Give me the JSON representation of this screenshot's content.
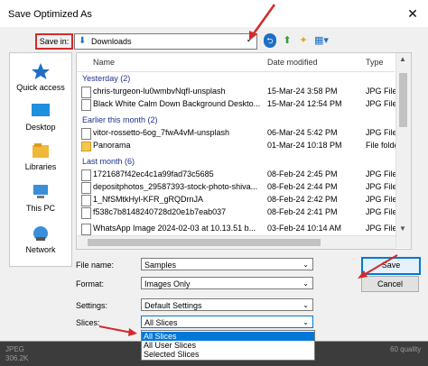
{
  "window": {
    "title": "Save Optimized As",
    "close_glyph": "✕"
  },
  "save_in": {
    "label": "Save in:",
    "location": "Downloads",
    "toolbar": {
      "back": "⮌",
      "up": "⬆",
      "new_folder": "✦",
      "views": "▦▾"
    }
  },
  "places": [
    {
      "label": "Quick access",
      "icon": "star-icon"
    },
    {
      "label": "Desktop",
      "icon": "desktop-icon"
    },
    {
      "label": "Libraries",
      "icon": "libraries-icon"
    },
    {
      "label": "This PC",
      "icon": "computer-icon"
    },
    {
      "label": "Network",
      "icon": "network-icon"
    }
  ],
  "file_list": {
    "columns": [
      "Name",
      "Date modified",
      "Type"
    ],
    "groups": [
      {
        "title": "Yesterday (2)",
        "rows": [
          {
            "name": "chris-turgeon-lu0wmbvNqfI-unsplash",
            "date": "15-Mar-24 3:58 PM",
            "type": "JPG File",
            "kind": "file"
          },
          {
            "name": "Black White Calm Down Background Deskto...",
            "date": "15-Mar-24 12:54 PM",
            "type": "JPG File",
            "kind": "file"
          }
        ]
      },
      {
        "title": "Earlier this month (2)",
        "rows": [
          {
            "name": "vitor-rossetto-6og_7fwA4vM-unsplash",
            "date": "06-Mar-24 5:42 PM",
            "type": "JPG File",
            "kind": "file"
          },
          {
            "name": "Panorama",
            "date": "01-Mar-24 10:18 PM",
            "type": "File folder",
            "kind": "folder"
          }
        ]
      },
      {
        "title": "Last month (6)",
        "rows": [
          {
            "name": "1721687f42ec4c1a99fad73c5685",
            "date": "08-Feb-24 2:45 PM",
            "type": "JPG File",
            "kind": "file"
          },
          {
            "name": "depositphotos_29587393-stock-photo-shiva...",
            "date": "08-Feb-24 2:44 PM",
            "type": "JPG File",
            "kind": "file"
          },
          {
            "name": "1_NfSMtkHyl-KFR_gRQDrnJA",
            "date": "08-Feb-24 2:42 PM",
            "type": "JPG File",
            "kind": "file"
          },
          {
            "name": "f538c7b8148240728d20e1b7eab037",
            "date": "08-Feb-24 2:41 PM",
            "type": "JPG File",
            "kind": "file"
          },
          {
            "name": "WhatsApp Image 2024-02-03 at 10.13.51 b...",
            "date": "03-Feb-24 10:14 AM",
            "type": "JPG File",
            "kind": "file"
          }
        ]
      }
    ]
  },
  "form": {
    "file_name_label": "File name:",
    "file_name_value": "Samples",
    "format_label": "Format:",
    "format_value": "Images Only",
    "settings_label": "Settings:",
    "settings_value": "Default Settings",
    "slices_label": "Slices:",
    "slices_value": "All Slices",
    "slices_options": [
      "All Slices",
      "All User Slices",
      "Selected Slices"
    ]
  },
  "buttons": {
    "save": "Save",
    "cancel": "Cancel"
  },
  "status": {
    "left_line1": "JPEG",
    "left_line2": "306.2K",
    "right": "60 quality"
  },
  "colors": {
    "annotation": "#d32a2a",
    "selection": "#0078d7",
    "group_header": "#1e3287"
  }
}
